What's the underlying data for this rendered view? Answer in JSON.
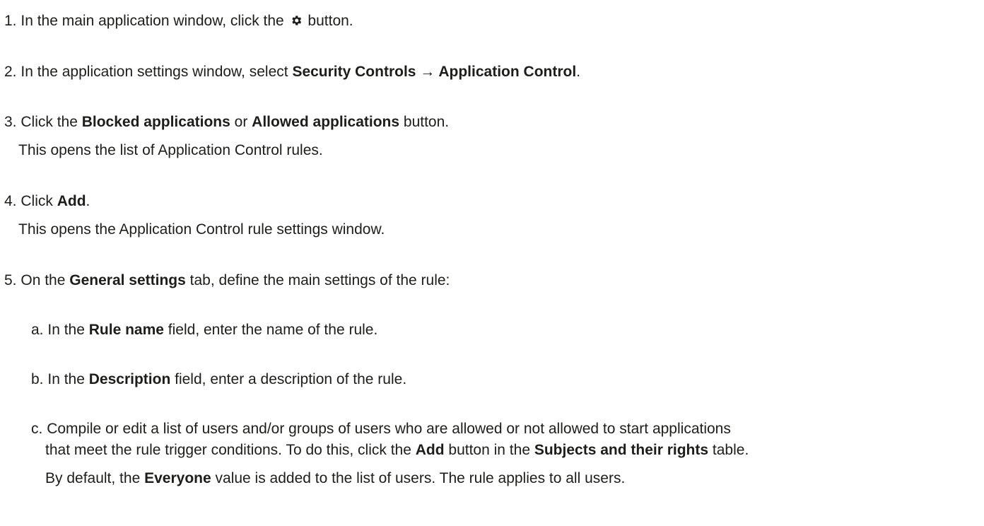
{
  "steps": [
    {
      "number": "1.",
      "parts": [
        "In the main application window, click the",
        "button."
      ],
      "icon": "gear-icon"
    },
    {
      "number": "2.",
      "parts": [
        "In the application settings window, select",
        "Security Controls → Application Control",
        "."
      ]
    },
    {
      "number": "3.",
      "parts": [
        "Click the",
        "Blocked applications",
        "or",
        "Allowed applications",
        "button."
      ],
      "note": "This opens the list of Application Control rules."
    },
    {
      "number": "4.",
      "parts": [
        "Click",
        "Add",
        "."
      ],
      "note": "This opens the Application Control rule settings window."
    },
    {
      "number": "5.",
      "parts": [
        "On the",
        "General settings",
        "tab, define the main settings of the rule:"
      ]
    }
  ],
  "substeps": [
    {
      "letter": "a.",
      "parts": [
        "In the",
        "Rule name",
        "field, enter the name of the rule."
      ]
    },
    {
      "letter": "b.",
      "parts": [
        "In the",
        "Description",
        "field, enter a description of the rule."
      ]
    },
    {
      "letter": "c.",
      "line1": "Compile or edit a list of users and/or groups of users who are allowed or not allowed to start applications",
      "line2_parts": [
        "that meet the rule trigger conditions. To do this, click the",
        "Add",
        "button in the",
        "Subjects and their rights",
        "table."
      ],
      "note_parts": [
        "By default, the",
        "Everyone",
        "value is added to the list of users. The rule applies to all users."
      ]
    }
  ]
}
